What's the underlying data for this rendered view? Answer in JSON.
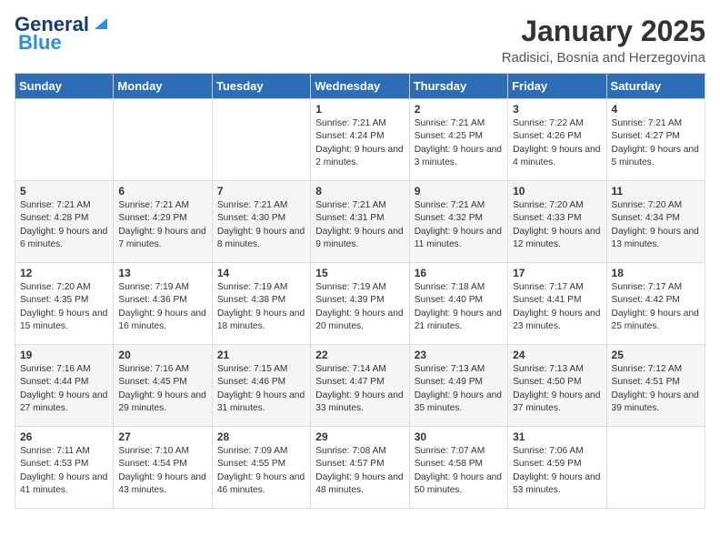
{
  "header": {
    "logo_general": "General",
    "logo_blue": "Blue",
    "month_title": "January 2025",
    "location": "Radisici, Bosnia and Herzegovina"
  },
  "days_of_week": [
    "Sunday",
    "Monday",
    "Tuesday",
    "Wednesday",
    "Thursday",
    "Friday",
    "Saturday"
  ],
  "weeks": [
    {
      "cells": [
        {
          "day": "",
          "content": ""
        },
        {
          "day": "",
          "content": ""
        },
        {
          "day": "",
          "content": ""
        },
        {
          "day": "1",
          "content": "Sunrise: 7:21 AM\nSunset: 4:24 PM\nDaylight: 9 hours and 2 minutes."
        },
        {
          "day": "2",
          "content": "Sunrise: 7:21 AM\nSunset: 4:25 PM\nDaylight: 9 hours and 3 minutes."
        },
        {
          "day": "3",
          "content": "Sunrise: 7:22 AM\nSunset: 4:26 PM\nDaylight: 9 hours and 4 minutes."
        },
        {
          "day": "4",
          "content": "Sunrise: 7:21 AM\nSunset: 4:27 PM\nDaylight: 9 hours and 5 minutes."
        }
      ]
    },
    {
      "cells": [
        {
          "day": "5",
          "content": "Sunrise: 7:21 AM\nSunset: 4:28 PM\nDaylight: 9 hours and 6 minutes."
        },
        {
          "day": "6",
          "content": "Sunrise: 7:21 AM\nSunset: 4:29 PM\nDaylight: 9 hours and 7 minutes."
        },
        {
          "day": "7",
          "content": "Sunrise: 7:21 AM\nSunset: 4:30 PM\nDaylight: 9 hours and 8 minutes."
        },
        {
          "day": "8",
          "content": "Sunrise: 7:21 AM\nSunset: 4:31 PM\nDaylight: 9 hours and 9 minutes."
        },
        {
          "day": "9",
          "content": "Sunrise: 7:21 AM\nSunset: 4:32 PM\nDaylight: 9 hours and 11 minutes."
        },
        {
          "day": "10",
          "content": "Sunrise: 7:20 AM\nSunset: 4:33 PM\nDaylight: 9 hours and 12 minutes."
        },
        {
          "day": "11",
          "content": "Sunrise: 7:20 AM\nSunset: 4:34 PM\nDaylight: 9 hours and 13 minutes."
        }
      ]
    },
    {
      "cells": [
        {
          "day": "12",
          "content": "Sunrise: 7:20 AM\nSunset: 4:35 PM\nDaylight: 9 hours and 15 minutes."
        },
        {
          "day": "13",
          "content": "Sunrise: 7:19 AM\nSunset: 4:36 PM\nDaylight: 9 hours and 16 minutes."
        },
        {
          "day": "14",
          "content": "Sunrise: 7:19 AM\nSunset: 4:38 PM\nDaylight: 9 hours and 18 minutes."
        },
        {
          "day": "15",
          "content": "Sunrise: 7:19 AM\nSunset: 4:39 PM\nDaylight: 9 hours and 20 minutes."
        },
        {
          "day": "16",
          "content": "Sunrise: 7:18 AM\nSunset: 4:40 PM\nDaylight: 9 hours and 21 minutes."
        },
        {
          "day": "17",
          "content": "Sunrise: 7:17 AM\nSunset: 4:41 PM\nDaylight: 9 hours and 23 minutes."
        },
        {
          "day": "18",
          "content": "Sunrise: 7:17 AM\nSunset: 4:42 PM\nDaylight: 9 hours and 25 minutes."
        }
      ]
    },
    {
      "cells": [
        {
          "day": "19",
          "content": "Sunrise: 7:16 AM\nSunset: 4:44 PM\nDaylight: 9 hours and 27 minutes."
        },
        {
          "day": "20",
          "content": "Sunrise: 7:16 AM\nSunset: 4:45 PM\nDaylight: 9 hours and 29 minutes."
        },
        {
          "day": "21",
          "content": "Sunrise: 7:15 AM\nSunset: 4:46 PM\nDaylight: 9 hours and 31 minutes."
        },
        {
          "day": "22",
          "content": "Sunrise: 7:14 AM\nSunset: 4:47 PM\nDaylight: 9 hours and 33 minutes."
        },
        {
          "day": "23",
          "content": "Sunrise: 7:13 AM\nSunset: 4:49 PM\nDaylight: 9 hours and 35 minutes."
        },
        {
          "day": "24",
          "content": "Sunrise: 7:13 AM\nSunset: 4:50 PM\nDaylight: 9 hours and 37 minutes."
        },
        {
          "day": "25",
          "content": "Sunrise: 7:12 AM\nSunset: 4:51 PM\nDaylight: 9 hours and 39 minutes."
        }
      ]
    },
    {
      "cells": [
        {
          "day": "26",
          "content": "Sunrise: 7:11 AM\nSunset: 4:53 PM\nDaylight: 9 hours and 41 minutes."
        },
        {
          "day": "27",
          "content": "Sunrise: 7:10 AM\nSunset: 4:54 PM\nDaylight: 9 hours and 43 minutes."
        },
        {
          "day": "28",
          "content": "Sunrise: 7:09 AM\nSunset: 4:55 PM\nDaylight: 9 hours and 46 minutes."
        },
        {
          "day": "29",
          "content": "Sunrise: 7:08 AM\nSunset: 4:57 PM\nDaylight: 9 hours and 48 minutes."
        },
        {
          "day": "30",
          "content": "Sunrise: 7:07 AM\nSunset: 4:58 PM\nDaylight: 9 hours and 50 minutes."
        },
        {
          "day": "31",
          "content": "Sunrise: 7:06 AM\nSunset: 4:59 PM\nDaylight: 9 hours and 53 minutes."
        },
        {
          "day": "",
          "content": ""
        }
      ]
    }
  ]
}
